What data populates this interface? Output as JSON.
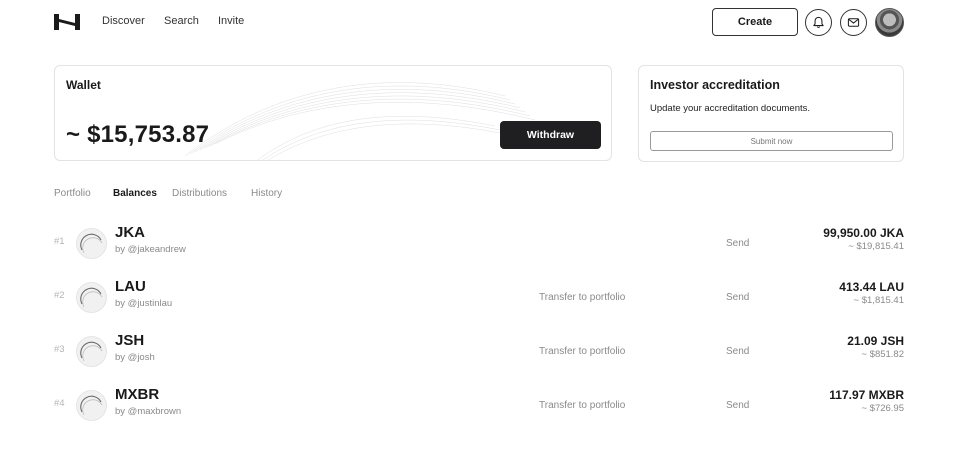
{
  "nav": {
    "links": [
      "Discover",
      "Search",
      "Invite"
    ],
    "create_label": "Create",
    "icons": [
      "logo-icon",
      "bell-icon",
      "mail-icon",
      "avatar"
    ]
  },
  "wallet": {
    "title": "Wallet",
    "balance": "~ $15,753.87",
    "withdraw_label": "Withdraw"
  },
  "accreditation": {
    "title": "Investor accreditation",
    "description": "Update your accreditation documents.",
    "submit_label": "Submit now"
  },
  "tabs": [
    {
      "label": "Portfolio",
      "active": false
    },
    {
      "label": "Balances",
      "active": true
    },
    {
      "label": "Distributions",
      "active": false
    },
    {
      "label": "History",
      "active": false
    }
  ],
  "balances": [
    {
      "rank": "#1",
      "ticker": "JKA",
      "handle": "by @jakeandrew",
      "transfer_label": "",
      "send_label": "Send",
      "amount": "99,950.00 JKA",
      "usd": "~ $19,815.41"
    },
    {
      "rank": "#2",
      "ticker": "LAU",
      "handle": "by @justinlau",
      "transfer_label": "Transfer to portfolio",
      "send_label": "Send",
      "amount": "413.44 LAU",
      "usd": "~ $1,815.41"
    },
    {
      "rank": "#3",
      "ticker": "JSH",
      "handle": "by @josh",
      "transfer_label": "Transfer to portfolio",
      "send_label": "Send",
      "amount": "21.09 JSH",
      "usd": "~ $851.82"
    },
    {
      "rank": "#4",
      "ticker": "MXBR",
      "handle": "by @maxbrown",
      "transfer_label": "Transfer to portfolio",
      "send_label": "Send",
      "amount": "117.97 MXBR",
      "usd": "~ $726.95"
    }
  ],
  "colors": {
    "primary_button": "#1f1f21",
    "muted_text": "#8a8a8a",
    "border": "#e3e3e3"
  }
}
